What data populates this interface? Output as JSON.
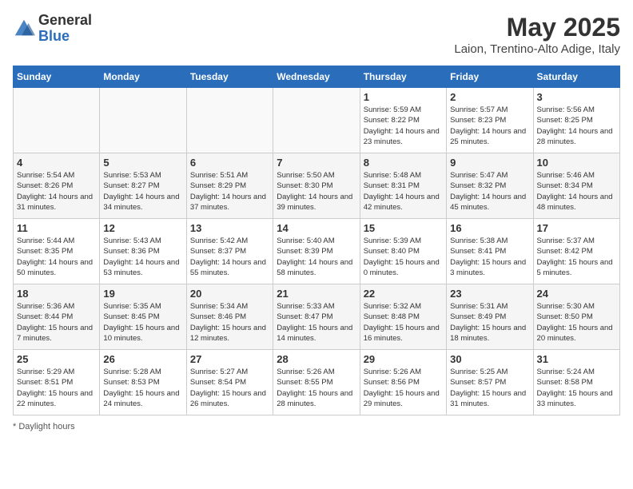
{
  "logo": {
    "general": "General",
    "blue": "Blue"
  },
  "title": "May 2025",
  "subtitle": "Laion, Trentino-Alto Adige, Italy",
  "days_of_week": [
    "Sunday",
    "Monday",
    "Tuesday",
    "Wednesday",
    "Thursday",
    "Friday",
    "Saturday"
  ],
  "footer": "Daylight hours",
  "weeks": [
    [
      {
        "day": "",
        "info": ""
      },
      {
        "day": "",
        "info": ""
      },
      {
        "day": "",
        "info": ""
      },
      {
        "day": "",
        "info": ""
      },
      {
        "day": "1",
        "info": "Sunrise: 5:59 AM\nSunset: 8:22 PM\nDaylight: 14 hours\nand 23 minutes."
      },
      {
        "day": "2",
        "info": "Sunrise: 5:57 AM\nSunset: 8:23 PM\nDaylight: 14 hours\nand 25 minutes."
      },
      {
        "day": "3",
        "info": "Sunrise: 5:56 AM\nSunset: 8:25 PM\nDaylight: 14 hours\nand 28 minutes."
      }
    ],
    [
      {
        "day": "4",
        "info": "Sunrise: 5:54 AM\nSunset: 8:26 PM\nDaylight: 14 hours\nand 31 minutes."
      },
      {
        "day": "5",
        "info": "Sunrise: 5:53 AM\nSunset: 8:27 PM\nDaylight: 14 hours\nand 34 minutes."
      },
      {
        "day": "6",
        "info": "Sunrise: 5:51 AM\nSunset: 8:29 PM\nDaylight: 14 hours\nand 37 minutes."
      },
      {
        "day": "7",
        "info": "Sunrise: 5:50 AM\nSunset: 8:30 PM\nDaylight: 14 hours\nand 39 minutes."
      },
      {
        "day": "8",
        "info": "Sunrise: 5:48 AM\nSunset: 8:31 PM\nDaylight: 14 hours\nand 42 minutes."
      },
      {
        "day": "9",
        "info": "Sunrise: 5:47 AM\nSunset: 8:32 PM\nDaylight: 14 hours\nand 45 minutes."
      },
      {
        "day": "10",
        "info": "Sunrise: 5:46 AM\nSunset: 8:34 PM\nDaylight: 14 hours\nand 48 minutes."
      }
    ],
    [
      {
        "day": "11",
        "info": "Sunrise: 5:44 AM\nSunset: 8:35 PM\nDaylight: 14 hours\nand 50 minutes."
      },
      {
        "day": "12",
        "info": "Sunrise: 5:43 AM\nSunset: 8:36 PM\nDaylight: 14 hours\nand 53 minutes."
      },
      {
        "day": "13",
        "info": "Sunrise: 5:42 AM\nSunset: 8:37 PM\nDaylight: 14 hours\nand 55 minutes."
      },
      {
        "day": "14",
        "info": "Sunrise: 5:40 AM\nSunset: 8:39 PM\nDaylight: 14 hours\nand 58 minutes."
      },
      {
        "day": "15",
        "info": "Sunrise: 5:39 AM\nSunset: 8:40 PM\nDaylight: 15 hours\nand 0 minutes."
      },
      {
        "day": "16",
        "info": "Sunrise: 5:38 AM\nSunset: 8:41 PM\nDaylight: 15 hours\nand 3 minutes."
      },
      {
        "day": "17",
        "info": "Sunrise: 5:37 AM\nSunset: 8:42 PM\nDaylight: 15 hours\nand 5 minutes."
      }
    ],
    [
      {
        "day": "18",
        "info": "Sunrise: 5:36 AM\nSunset: 8:44 PM\nDaylight: 15 hours\nand 7 minutes."
      },
      {
        "day": "19",
        "info": "Sunrise: 5:35 AM\nSunset: 8:45 PM\nDaylight: 15 hours\nand 10 minutes."
      },
      {
        "day": "20",
        "info": "Sunrise: 5:34 AM\nSunset: 8:46 PM\nDaylight: 15 hours\nand 12 minutes."
      },
      {
        "day": "21",
        "info": "Sunrise: 5:33 AM\nSunset: 8:47 PM\nDaylight: 15 hours\nand 14 minutes."
      },
      {
        "day": "22",
        "info": "Sunrise: 5:32 AM\nSunset: 8:48 PM\nDaylight: 15 hours\nand 16 minutes."
      },
      {
        "day": "23",
        "info": "Sunrise: 5:31 AM\nSunset: 8:49 PM\nDaylight: 15 hours\nand 18 minutes."
      },
      {
        "day": "24",
        "info": "Sunrise: 5:30 AM\nSunset: 8:50 PM\nDaylight: 15 hours\nand 20 minutes."
      }
    ],
    [
      {
        "day": "25",
        "info": "Sunrise: 5:29 AM\nSunset: 8:51 PM\nDaylight: 15 hours\nand 22 minutes."
      },
      {
        "day": "26",
        "info": "Sunrise: 5:28 AM\nSunset: 8:53 PM\nDaylight: 15 hours\nand 24 minutes."
      },
      {
        "day": "27",
        "info": "Sunrise: 5:27 AM\nSunset: 8:54 PM\nDaylight: 15 hours\nand 26 minutes."
      },
      {
        "day": "28",
        "info": "Sunrise: 5:26 AM\nSunset: 8:55 PM\nDaylight: 15 hours\nand 28 minutes."
      },
      {
        "day": "29",
        "info": "Sunrise: 5:26 AM\nSunset: 8:56 PM\nDaylight: 15 hours\nand 29 minutes."
      },
      {
        "day": "30",
        "info": "Sunrise: 5:25 AM\nSunset: 8:57 PM\nDaylight: 15 hours\nand 31 minutes."
      },
      {
        "day": "31",
        "info": "Sunrise: 5:24 AM\nSunset: 8:58 PM\nDaylight: 15 hours\nand 33 minutes."
      }
    ]
  ]
}
